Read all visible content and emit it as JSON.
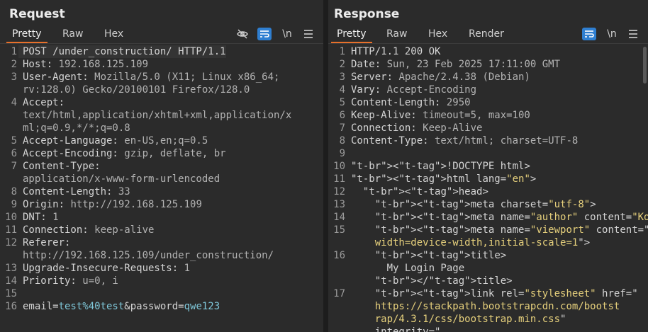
{
  "request": {
    "title": "Request",
    "tabs": [
      "Pretty",
      "Raw",
      "Hex"
    ],
    "active_tab": "Pretty",
    "tools": {
      "hide_icon": "eye-off-icon",
      "wrap_icon": "wrap-lines-icon",
      "newline_label": "\\n",
      "menu_icon": "hamburger-menu-icon"
    },
    "lines": [
      {
        "n": "1",
        "rows": [
          "POST /under_construction/ HTTP/1.1"
        ]
      },
      {
        "n": "2",
        "key": "Host",
        "rows": [
          "Host: 192.168.125.109"
        ]
      },
      {
        "n": "3",
        "rows": [
          "User-Agent: Mozilla/5.0 (X11; Linux x86_64;",
          "rv:128.0) Gecko/20100101 Firefox/128.0"
        ]
      },
      {
        "n": "4",
        "rows": [
          "Accept:",
          "text/html,application/xhtml+xml,application/x",
          "ml;q=0.9,*/*;q=0.8"
        ]
      },
      {
        "n": "5",
        "rows": [
          "Accept-Language: en-US,en;q=0.5"
        ]
      },
      {
        "n": "6",
        "rows": [
          "Accept-Encoding: gzip, deflate, br"
        ]
      },
      {
        "n": "7",
        "rows": [
          "Content-Type:",
          "application/x-www-form-urlencoded"
        ]
      },
      {
        "n": "8",
        "rows": [
          "Content-Length: 33"
        ]
      },
      {
        "n": "9",
        "rows": [
          "Origin: http://192.168.125.109"
        ]
      },
      {
        "n": "10",
        "rows": [
          "DNT: 1"
        ]
      },
      {
        "n": "11",
        "rows": [
          "Connection: keep-alive"
        ]
      },
      {
        "n": "12",
        "rows": [
          "Referer:",
          "http://192.168.125.109/under_construction/"
        ]
      },
      {
        "n": "13",
        "rows": [
          "Upgrade-Insecure-Requests: 1"
        ]
      },
      {
        "n": "14",
        "rows": [
          "Priority: u=0, i"
        ]
      },
      {
        "n": "15",
        "rows": [
          ""
        ]
      },
      {
        "n": "16",
        "rows": [
          "email=test%40test&password=qwe123"
        ]
      }
    ]
  },
  "response": {
    "title": "Response",
    "tabs": [
      "Pretty",
      "Raw",
      "Hex",
      "Render"
    ],
    "active_tab": "Pretty",
    "tools": {
      "wrap_icon": "wrap-lines-icon",
      "newline_label": "\\n",
      "menu_icon": "hamburger-menu-icon"
    },
    "lines": [
      {
        "n": "1",
        "rows": [
          "HTTP/1.1 200 OK"
        ]
      },
      {
        "n": "2",
        "rows": [
          "Date: Sun, 23 Feb 2025 17:11:00 GMT"
        ]
      },
      {
        "n": "3",
        "rows": [
          "Server: Apache/2.4.38 (Debian)"
        ]
      },
      {
        "n": "4",
        "rows": [
          "Vary: Accept-Encoding"
        ]
      },
      {
        "n": "5",
        "rows": [
          "Content-Length: 2950"
        ]
      },
      {
        "n": "6",
        "rows": [
          "Keep-Alive: timeout=5, max=100"
        ]
      },
      {
        "n": "7",
        "rows": [
          "Connection: Keep-Alive"
        ]
      },
      {
        "n": "8",
        "rows": [
          "Content-Type: text/html; charset=UTF-8"
        ]
      },
      {
        "n": "9",
        "rows": [
          ""
        ]
      },
      {
        "n": "10",
        "rows": [
          "<!DOCTYPE html>"
        ]
      },
      {
        "n": "11",
        "rows": [
          "<html lang=\"en\">"
        ]
      },
      {
        "n": "12",
        "rows": [
          "  <head>"
        ]
      },
      {
        "n": "13",
        "rows": [
          "    <meta charset=\"utf-8\">"
        ]
      },
      {
        "n": "14",
        "rows": [
          "    <meta name=\"author\" content=\"Kodinger\">"
        ]
      },
      {
        "n": "15",
        "rows": [
          "    <meta name=\"viewport\" content=\"",
          "    width=device-width,initial-scale=1\">"
        ]
      },
      {
        "n": "16",
        "rows": [
          "    <title>",
          "      My Login Page",
          "    </title>"
        ]
      },
      {
        "n": "17",
        "rows": [
          "    <link rel=\"stylesheet\" href=\"",
          "    https://stackpath.bootstrapcdn.com/bootst",
          "    rap/4.3.1/css/bootstrap.min.css\"",
          "    integrity=\""
        ]
      }
    ]
  },
  "colors": {
    "background": "#2b2b2b",
    "accent": "#e8702a",
    "toggle_blue": "#2f7fd1"
  }
}
